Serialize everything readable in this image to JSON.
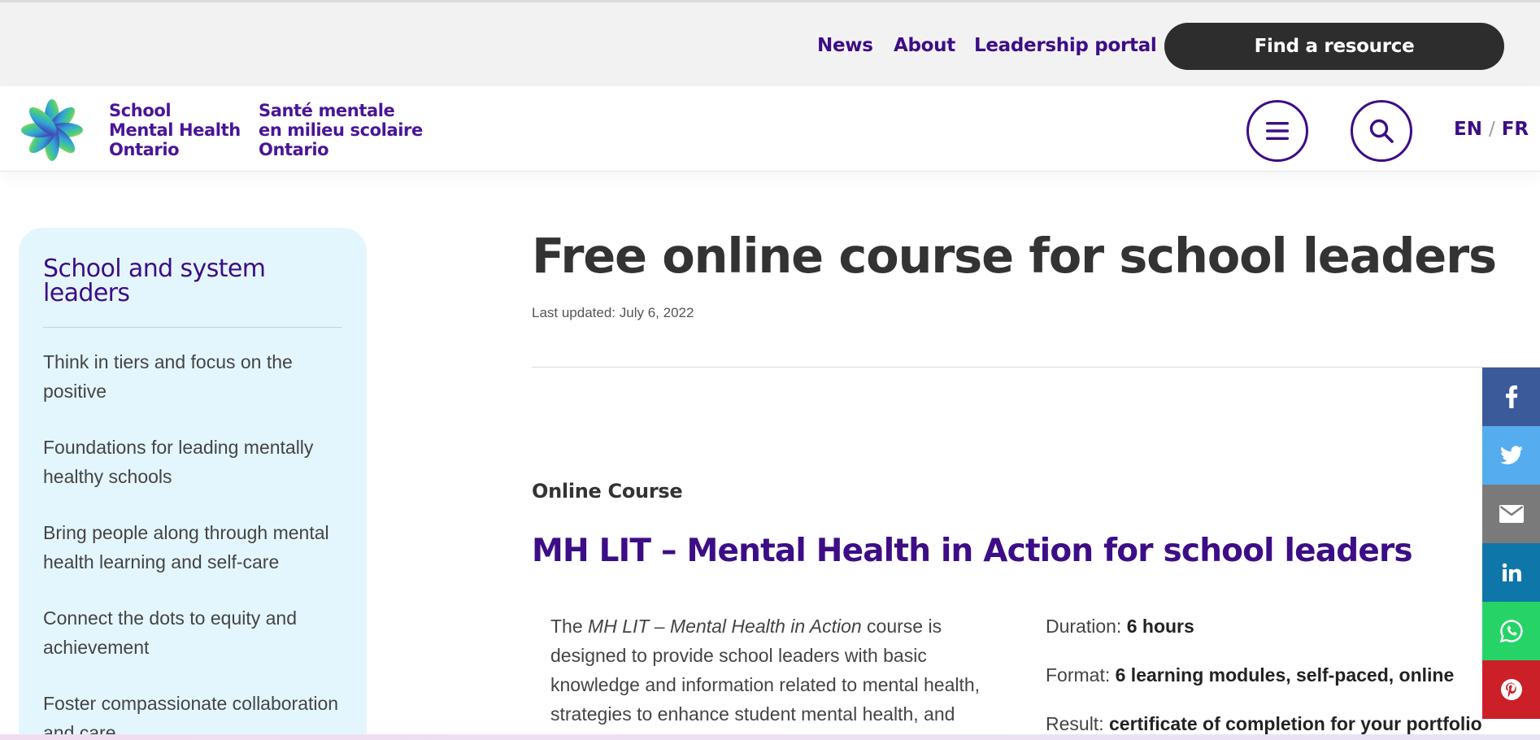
{
  "topnav": {
    "links": [
      "News",
      "About",
      "Leadership portal"
    ],
    "cta": "Find a resource"
  },
  "brand": {
    "en": [
      "School",
      "Mental Health",
      "Ontario"
    ],
    "fr": [
      "Santé mentale",
      "en milieu scolaire",
      "Ontario"
    ],
    "colors": {
      "purple": "#3d0d86",
      "dark": "#2d2d2d"
    }
  },
  "header": {
    "menu_icon": "hamburger-icon",
    "search_icon": "search-icon",
    "lang_en": "EN",
    "lang_sep": "/",
    "lang_fr": "FR"
  },
  "sidebar": {
    "title": "School and system leaders",
    "items": [
      "Think in tiers and focus on the positive",
      "Foundations for leading mentally healthy schools",
      "Bring people along through mental health learning and self-care",
      "Connect the dots to equity and achievement",
      "Foster compassionate collaboration and care"
    ]
  },
  "main": {
    "title": "Free online course for school leaders",
    "updated": "Last updated: July 6, 2022",
    "eyebrow": "Online Course",
    "course_title": "MH LIT – Mental Health in Action for school leaders",
    "desc_pre": "The ",
    "desc_em": "MH LIT – Mental Health in Action",
    "desc_post": " course is designed to provide school leaders with basic knowledge and information related to mental health, strategies to enhance student mental health, and",
    "facts": [
      {
        "label": "Duration: ",
        "value": "6 hours"
      },
      {
        "label": "Format: ",
        "value": "6 learning modules, self-paced, online"
      },
      {
        "label": "Result: ",
        "value": "certificate of completion for your portfolio"
      }
    ]
  },
  "share": [
    {
      "icon": "facebook-icon",
      "color": "#3b5a9a"
    },
    {
      "icon": "twitter-icon",
      "color": "#55acee"
    },
    {
      "icon": "email-icon",
      "color": "#7a7a7a"
    },
    {
      "icon": "linkedin-icon",
      "color": "#0e76a8"
    },
    {
      "icon": "whatsapp-icon",
      "color": "#25d366"
    },
    {
      "icon": "pinterest-icon",
      "color": "#cb2027"
    }
  ]
}
